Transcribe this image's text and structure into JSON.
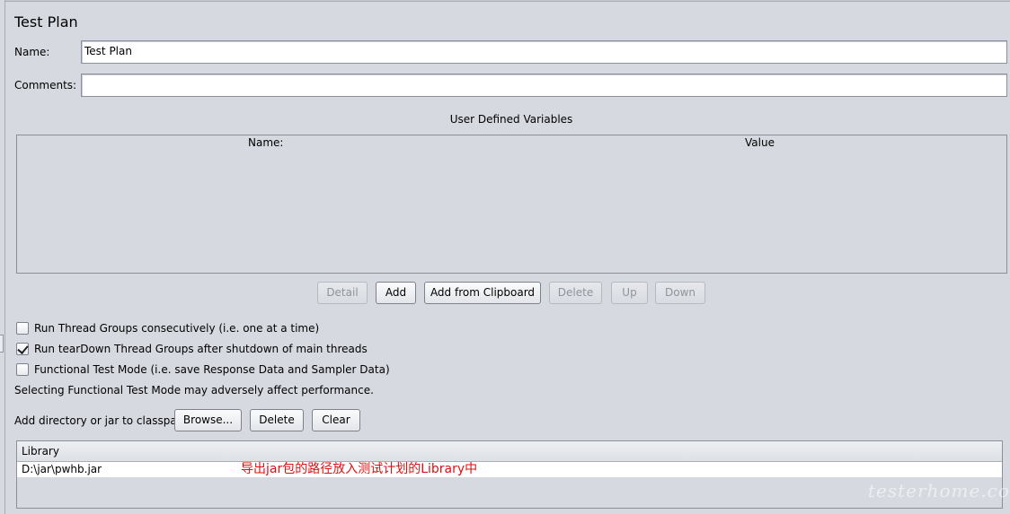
{
  "panel": {
    "title": "Test Plan",
    "name_label": "Name:",
    "name_value": "Test Plan",
    "comments_label": "Comments:",
    "comments_value": ""
  },
  "variables": {
    "title": "User Defined Variables",
    "columns": [
      "Name:",
      "Value"
    ],
    "rows": []
  },
  "table_buttons": {
    "detail": "Detail",
    "add": "Add",
    "add_clipboard": "Add from Clipboard",
    "delete": "Delete",
    "up": "Up",
    "down": "Down"
  },
  "options": {
    "run_consecutively": {
      "label": "Run Thread Groups consecutively (i.e. one at a time)",
      "checked": false
    },
    "run_teardown": {
      "label": "Run tearDown Thread Groups after shutdown of main threads",
      "checked": true
    },
    "functional_mode": {
      "label": "Functional Test Mode (i.e. save Response Data and Sampler Data)",
      "checked": false
    },
    "warning": "Selecting Functional Test Mode may adversely affect performance."
  },
  "classpath": {
    "label": "Add directory or jar to classpath",
    "browse": "Browse...",
    "delete": "Delete",
    "clear": "Clear",
    "column": "Library",
    "entries": [
      "D:\\jar\\pwhb.jar"
    ],
    "annotation": "导出jar包的路径放入测试计划的Library中"
  },
  "watermark": "testerhome.com"
}
